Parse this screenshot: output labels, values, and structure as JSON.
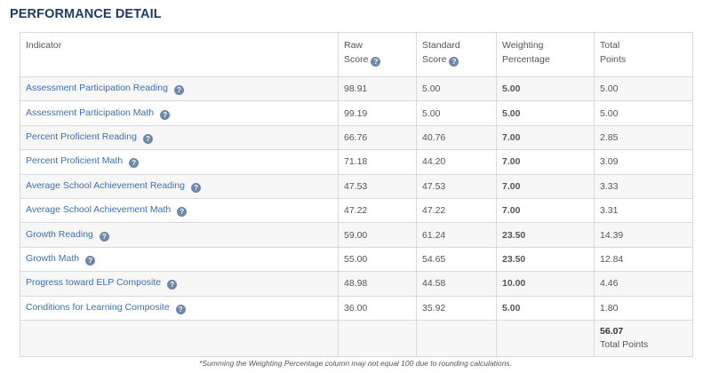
{
  "section_title": "PERFORMANCE DETAIL",
  "columns": {
    "indicator": "Indicator",
    "raw_line1": "Raw",
    "raw_line2": "Score",
    "std_line1": "Standard",
    "std_line2": "Score",
    "weight_line1": "Weighting",
    "weight_line2": "Percentage",
    "total_line1": "Total",
    "total_line2": "Points"
  },
  "rows": [
    {
      "indicator": "Assessment Participation Reading",
      "raw": "98.91",
      "standard": "5.00",
      "weight": "5.00",
      "points": "5.00"
    },
    {
      "indicator": "Assessment Participation Math",
      "raw": "99.19",
      "standard": "5.00",
      "weight": "5.00",
      "points": "5.00"
    },
    {
      "indicator": "Percent Proficient Reading",
      "raw": "66.76",
      "standard": "40.76",
      "weight": "7.00",
      "points": "2.85"
    },
    {
      "indicator": "Percent Proficient Math",
      "raw": "71.18",
      "standard": "44.20",
      "weight": "7.00",
      "points": "3.09"
    },
    {
      "indicator": "Average School Achievement Reading",
      "raw": "47.53",
      "standard": "47.53",
      "weight": "7.00",
      "points": "3.33"
    },
    {
      "indicator": "Average School Achievement Math",
      "raw": "47.22",
      "standard": "47.22",
      "weight": "7.00",
      "points": "3.31"
    },
    {
      "indicator": "Growth Reading",
      "raw": "59.00",
      "standard": "61.24",
      "weight": "23.50",
      "points": "14.39"
    },
    {
      "indicator": "Growth Math",
      "raw": "55.00",
      "standard": "54.65",
      "weight": "23.50",
      "points": "12.84"
    },
    {
      "indicator": "Progress toward ELP Composite",
      "raw": "48.98",
      "standard": "44.58",
      "weight": "10.00",
      "points": "4.46"
    },
    {
      "indicator": "Conditions for Learning Composite",
      "raw": "36.00",
      "standard": "35.92",
      "weight": "5.00",
      "points": "1.80"
    }
  ],
  "total": {
    "value": "56.07",
    "label": "Total Points"
  },
  "help_icon_glyph": "?",
  "footnote": "*Summing the Weighting Percentage column may not equal 100 due to rounding calculations.",
  "colors": {
    "title": "#1f3a5f",
    "link": "#3d6fb0",
    "help_icon": "#6f87a8"
  }
}
